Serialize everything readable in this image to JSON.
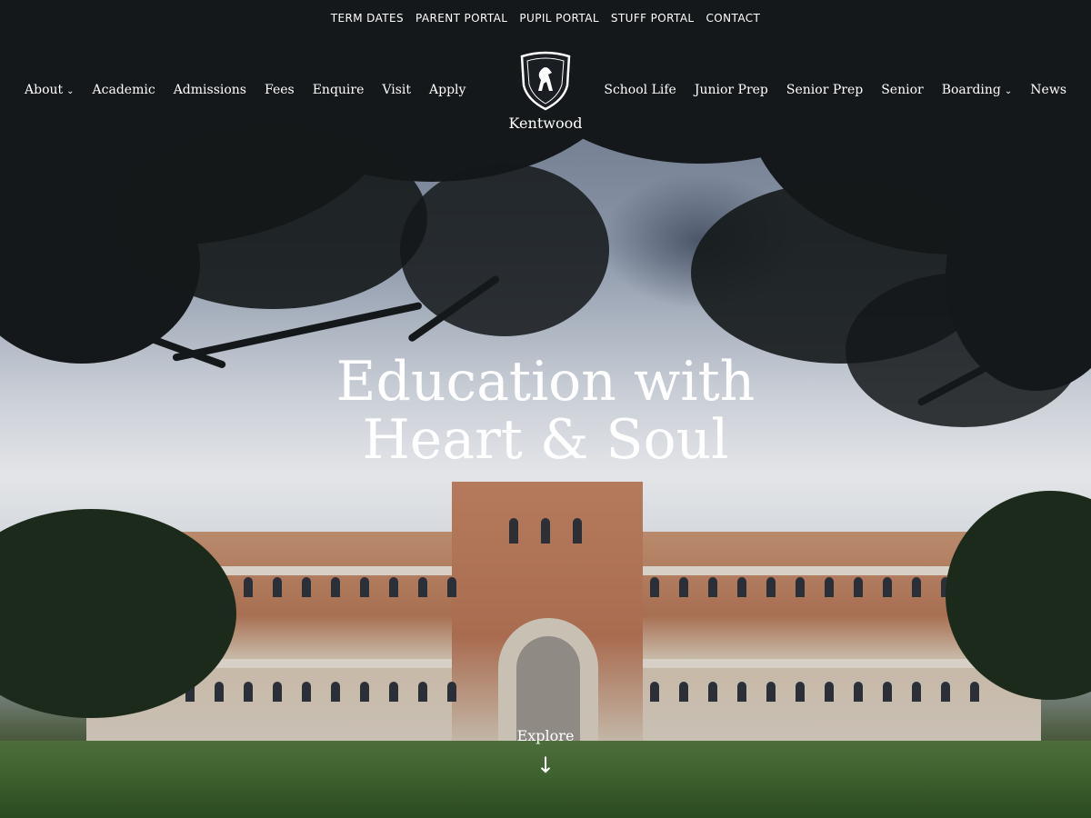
{
  "utility_nav": [
    "TERM DATES",
    "PARENT PORTAL",
    "PUPIL PORTAL",
    "STUFF PORTAL",
    "CONTACT"
  ],
  "main_nav_left": [
    {
      "label": "About",
      "dropdown": true
    },
    {
      "label": "Academic",
      "dropdown": false
    },
    {
      "label": "Admissions",
      "dropdown": false
    },
    {
      "label": "Fees",
      "dropdown": false
    },
    {
      "label": "Enquire",
      "dropdown": false
    },
    {
      "label": "Visit",
      "dropdown": false
    },
    {
      "label": "Apply",
      "dropdown": false
    }
  ],
  "main_nav_right": [
    {
      "label": "School Life",
      "dropdown": false
    },
    {
      "label": "Junior Prep",
      "dropdown": false
    },
    {
      "label": "Senior Prep",
      "dropdown": false
    },
    {
      "label": "Senior",
      "dropdown": false
    },
    {
      "label": "Boarding",
      "dropdown": true
    },
    {
      "label": "News",
      "dropdown": false
    }
  ],
  "brand": {
    "name": "Kentwood",
    "logo_icon": "lion-shield-icon"
  },
  "hero": {
    "headline_line1": "Education with",
    "headline_line2": "Heart & Soul"
  },
  "explore": {
    "label": "Explore",
    "icon": "arrow-down-icon"
  },
  "colors": {
    "text": "#ffffff",
    "brick": "#a96c50",
    "lawn": "#3f6330",
    "foliage": "#14181a"
  }
}
